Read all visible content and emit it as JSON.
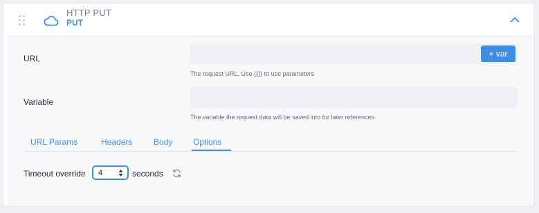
{
  "step": {
    "title": "HTTP PUT",
    "method": "PUT"
  },
  "icons": {
    "drag": "drag-handle-icon",
    "step": "cloud-icon",
    "collapse": "chevron-up-icon",
    "reset": "refresh-icon"
  },
  "url_field": {
    "label": "URL",
    "value": "",
    "placeholder": "",
    "var_button_label": "+ var",
    "help": "The request URL. Use {{}} to use parameters"
  },
  "variable_field": {
    "label": "Variable",
    "value": "",
    "placeholder": "",
    "help": "The variable the request data will be saved into for later references"
  },
  "tabs": [
    {
      "label": "URL Params",
      "active": false
    },
    {
      "label": "Headers",
      "active": false
    },
    {
      "label": "Body",
      "active": false
    },
    {
      "label": "Options",
      "active": true
    }
  ],
  "options": {
    "timeout_label": "Timeout override",
    "timeout_value": "4",
    "timeout_unit": "seconds"
  },
  "colors": {
    "accent": "#3f8ee6",
    "background": "#eef0f3",
    "panel": "#f7f8fa"
  }
}
